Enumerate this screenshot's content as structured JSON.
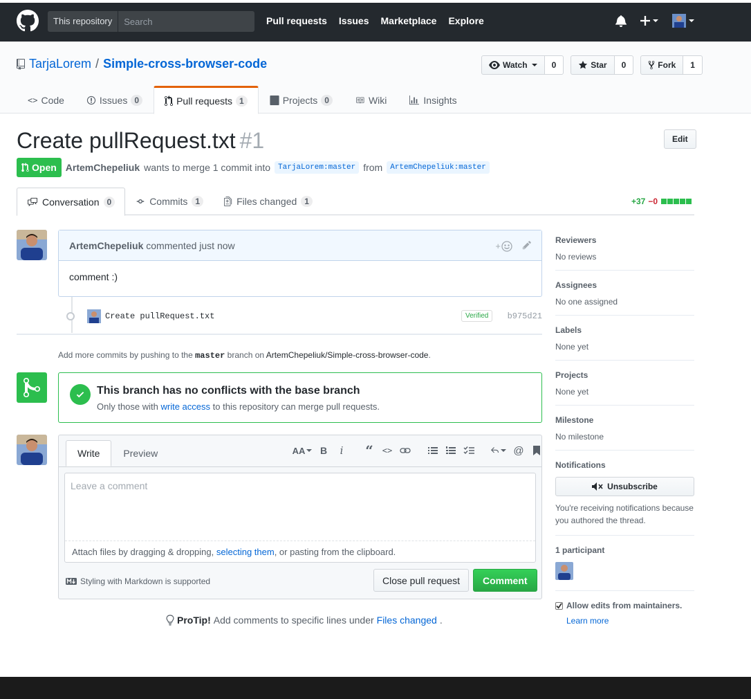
{
  "header": {
    "search_scope": "This repository",
    "search_placeholder": "Search",
    "nav": [
      "Pull requests",
      "Issues",
      "Marketplace",
      "Explore"
    ]
  },
  "repo": {
    "owner": "TarjaLorem",
    "separator": "/",
    "name": "Simple-cross-browser-code",
    "watch_label": "Watch",
    "watch_count": "0",
    "star_label": "Star",
    "star_count": "0",
    "fork_label": "Fork",
    "fork_count": "1",
    "tabs": [
      {
        "label": "Code",
        "count": ""
      },
      {
        "label": "Issues",
        "count": "0"
      },
      {
        "label": "Pull requests",
        "count": "1"
      },
      {
        "label": "Projects",
        "count": "0"
      },
      {
        "label": "Wiki",
        "count": ""
      },
      {
        "label": "Insights",
        "count": ""
      }
    ]
  },
  "pr": {
    "title": "Create pullRequest.txt",
    "number": "#1",
    "edit_label": "Edit",
    "state": "Open",
    "author": "ArtemChepeliuk",
    "merge_text": "wants to merge 1 commit into",
    "base_ref": "TarjaLorem:master",
    "from_text": "from",
    "head_ref": "ArtemChepeliuk:master",
    "tabs": [
      {
        "label": "Conversation",
        "count": "0"
      },
      {
        "label": "Commits",
        "count": "1"
      },
      {
        "label": "Files changed",
        "count": "1"
      }
    ],
    "additions": "+37",
    "deletions": "−0"
  },
  "comment": {
    "author": "ArtemChepeliuk",
    "meta": "commented just now",
    "body": "comment :)",
    "reaction_label": "+"
  },
  "commit": {
    "message": "Create pullRequest.txt",
    "verified": "Verified",
    "sha": "b975d21"
  },
  "add_commits": {
    "prefix": "Add more commits by pushing to the",
    "branch": "master",
    "middle": "branch on",
    "repo": "ArtemChepeliuk/Simple-cross-browser-code",
    "suffix": "."
  },
  "merge": {
    "title": "This branch has no conflicts with the base branch",
    "sub_prefix": "Only those with",
    "sub_link": "write access",
    "sub_suffix": "to this repository can merge pull requests."
  },
  "form": {
    "write_tab": "Write",
    "preview_tab": "Preview",
    "placeholder": "Leave a comment",
    "attach_prefix": "Attach files by dragging & dropping,",
    "attach_link": "selecting them",
    "attach_suffix": ", or pasting from the clipboard.",
    "markdown_note": "Styling with Markdown is supported",
    "close_label": "Close pull request",
    "comment_label": "Comment",
    "toolbar_heading": "AA"
  },
  "protip": {
    "label": "ProTip!",
    "text": "Add comments to specific lines under",
    "link": "Files changed",
    "end": "."
  },
  "sidebar": {
    "reviewers_heading": "Reviewers",
    "reviewers_value": "No reviews",
    "assignees_heading": "Assignees",
    "assignees_value": "No one assigned",
    "labels_heading": "Labels",
    "labels_value": "None yet",
    "projects_heading": "Projects",
    "projects_value": "None yet",
    "milestone_heading": "Milestone",
    "milestone_value": "No milestone",
    "notifications_heading": "Notifications",
    "unsubscribe_label": "Unsubscribe",
    "notifications_note": "You're receiving notifications because you authored the thread.",
    "participants_heading": "1 participant",
    "allow_edits": "Allow edits from maintainers.",
    "learn_more": "Learn more"
  },
  "colors": {
    "header_bg": "#24292e",
    "link": "#0366d6",
    "open_green": "#2cbe4e",
    "tab_accent": "#e36209"
  }
}
